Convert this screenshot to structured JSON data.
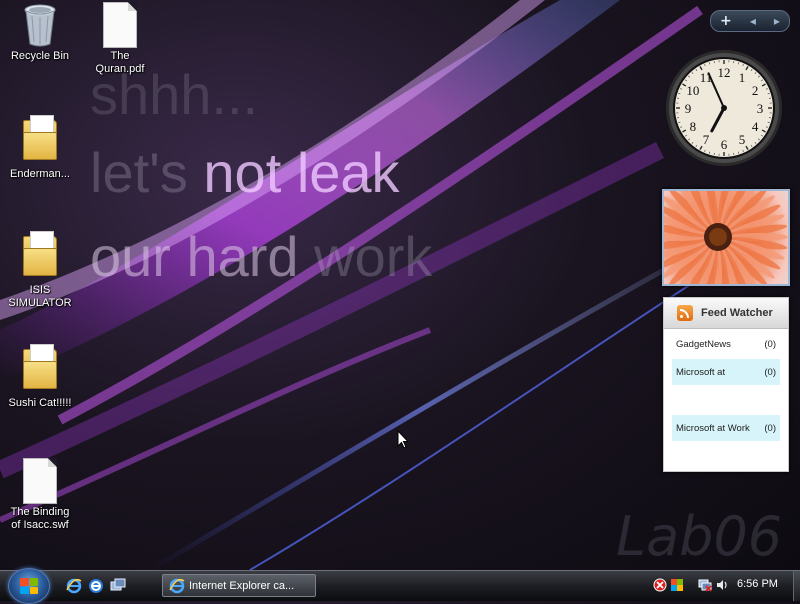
{
  "wallpaper": {
    "line1": "shhh...",
    "line2a": "let's ",
    "line2b": "not leak",
    "line3a": "our hard ",
    "line3b": "work",
    "watermark": "Lab06"
  },
  "desktop_icons": [
    {
      "label": "Recycle Bin",
      "icon": "recycle-bin-icon"
    },
    {
      "label": "The Quran.pdf",
      "label_lines": [
        "The",
        "Quran.pdf"
      ],
      "icon": "pdf-file-icon"
    },
    {
      "label": "Enderman...",
      "icon": "folder-icon"
    },
    {
      "label": "ISIS SIMULATOR",
      "label_lines": [
        "ISIS",
        "SIMULATOR"
      ],
      "icon": "folder-icon"
    },
    {
      "label": "Sushi Cat!!!!!",
      "icon": "folder-icon"
    },
    {
      "label": "The Binding of Isacc.swf",
      "label_lines": [
        "The Binding",
        "of Isacc.swf"
      ],
      "icon": "swf-file-icon"
    }
  ],
  "gadget_toolbar": {
    "add": "+",
    "prev": "◂",
    "next": "▸"
  },
  "clock_gadget": {
    "numbers": [
      "12",
      "1",
      "2",
      "3",
      "4",
      "5",
      "6",
      "7",
      "8",
      "9",
      "10",
      "11"
    ],
    "hour": 6,
    "minute": 56
  },
  "feed_watcher": {
    "title": "Feed Watcher",
    "items": [
      {
        "name": "GadgetNews",
        "count": "(0)",
        "highlight": false
      },
      {
        "name": "Microsoft at",
        "count": "(0)",
        "highlight": true
      },
      {
        "name": "Microsoft at Work",
        "count": "(0)",
        "highlight": true
      }
    ]
  },
  "taskbar": {
    "task_button_label": "Internet Explorer ca...",
    "clock": "6:56 PM",
    "colors": {
      "accent": "#2a5a9a"
    }
  }
}
